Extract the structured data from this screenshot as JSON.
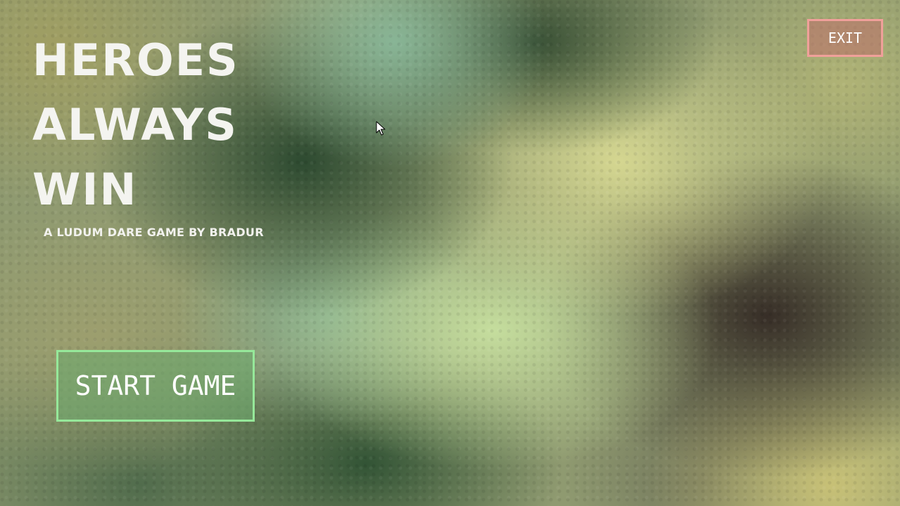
{
  "title": {
    "lines": [
      "HEROES",
      "ALWAYS",
      "WIN"
    ]
  },
  "subtitle": "A LUDUM DARE GAME BY BRADUR",
  "buttons": {
    "start_label": "START GAME",
    "exit_label": "EXIT"
  },
  "colors": {
    "start_border": "#96e89a",
    "exit_border": "#f0a09a",
    "title_text": "#f4f4f0"
  },
  "icons": {
    "cursor": "mouse-pointer-icon"
  }
}
